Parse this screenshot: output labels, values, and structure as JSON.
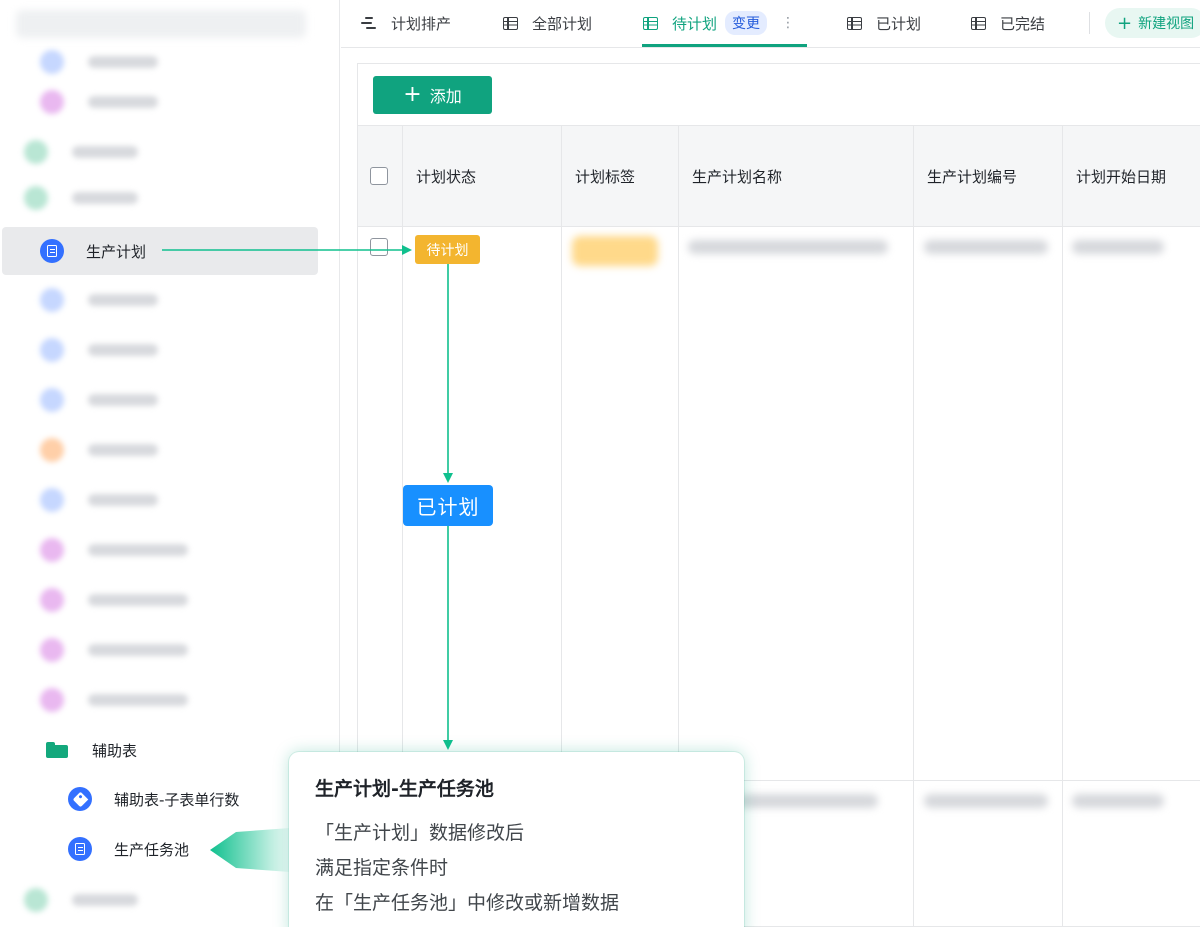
{
  "sidebar": {
    "active_item": "生产计划",
    "folder": "辅助表",
    "children": [
      "辅助表-子表单行数",
      "生产任务池"
    ],
    "icons": [
      "doc-icon",
      "folder-icon",
      "tag-icon"
    ]
  },
  "tabs": {
    "items": [
      "计划排产",
      "全部计划",
      "待计划",
      "已计划",
      "已完结"
    ],
    "active": "待计划",
    "badge": "变更",
    "more": "⋮",
    "new_view": "新建视图"
  },
  "toolbar": {
    "add_label": "添加"
  },
  "table": {
    "headers": [
      "计划状态",
      "计划标签",
      "生产计划名称",
      "生产计划编号",
      "计划开始日期"
    ],
    "row_status": "待计划"
  },
  "flow": {
    "target_status": "已计划"
  },
  "callout": {
    "title": "生产计划-生产任务池",
    "lines": [
      "「生产计划」数据修改后",
      "满足指定条件时",
      "在「生产任务池」中修改或新增数据"
    ]
  },
  "colors": {
    "accent": "#10a37f",
    "pending": "#f3b52f",
    "planned": "#1890ff",
    "doc_icon": "#3370ff"
  }
}
